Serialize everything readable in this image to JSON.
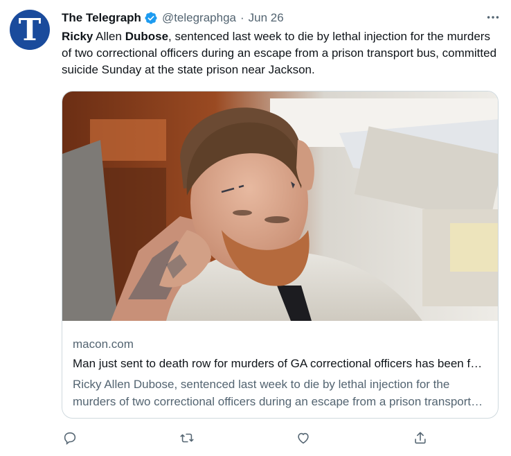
{
  "account": {
    "display_name": "The Telegraph",
    "handle": "@telegraphga",
    "separator": "·",
    "date": "Jun 26",
    "avatar_letter": "T",
    "avatar_color": "#1a4b9c",
    "verified_color": "#1d9bf0"
  },
  "tweet": {
    "segments": [
      {
        "text": "Ricky",
        "bold": true
      },
      {
        "text": " Allen ",
        "bold": false
      },
      {
        "text": "Dubose",
        "bold": true
      },
      {
        "text": ", sentenced last week to die by lethal injection for the murders of two correctional officers during an escape from a prison transport bus, committed suicide Sunday at the state prison near Jackson.",
        "bold": false
      }
    ]
  },
  "card": {
    "domain": "macon.com",
    "title": "Man just sent to death row for murders of GA correctional officers has been found dead in his cell",
    "description": "Ricky Allen Dubose, sentenced last week to die by lethal injection for the murders of two correctional officers during an escape from a prison transport bus, committed suicide Sunday at the state prison near Jackson."
  },
  "actions": [
    {
      "name": "reply",
      "icon": "reply-icon"
    },
    {
      "name": "retweet",
      "icon": "retweet-icon"
    },
    {
      "name": "like",
      "icon": "heart-icon"
    },
    {
      "name": "share",
      "icon": "share-icon"
    }
  ],
  "colors": {
    "text": "#0f1419",
    "secondary": "#536471",
    "border": "#cfd9de"
  }
}
